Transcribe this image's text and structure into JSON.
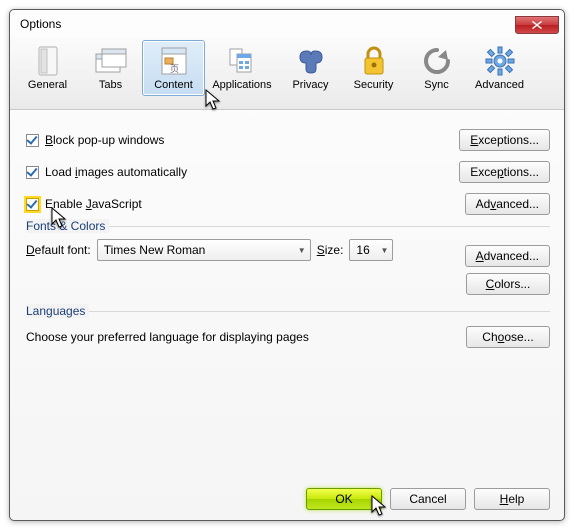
{
  "window": {
    "title": "Options"
  },
  "tabs": [
    {
      "label": "General"
    },
    {
      "label": "Tabs"
    },
    {
      "label": "Content"
    },
    {
      "label": "Applications"
    },
    {
      "label": "Privacy"
    },
    {
      "label": "Security"
    },
    {
      "label": "Sync"
    },
    {
      "label": "Advanced"
    }
  ],
  "content": {
    "block_popups_pre": "",
    "block_popups_key": "B",
    "block_popups_post": "lock pop-up windows",
    "load_images_pre": "Load ",
    "load_images_key": "i",
    "load_images_post": "mages automatically",
    "enable_js_pre": "Enable ",
    "enable_js_key": "J",
    "enable_js_post": "avaScript",
    "exceptions_key": "E",
    "exceptions_rest": "xceptions...",
    "exceptions2_pre": "Exce",
    "exceptions2_key": "p",
    "exceptions2_post": "tions...",
    "advanced_js_pre": "Ad",
    "advanced_js_key": "v",
    "advanced_js_post": "anced..."
  },
  "fonts": {
    "group_title": "Fonts & Colors",
    "default_font_key": "D",
    "default_font_rest": "efault font:",
    "default_font_value": "Times New Roman",
    "size_key": "S",
    "size_rest": "ize:",
    "size_value": "16",
    "advanced_key": "A",
    "advanced_rest": "dvanced...",
    "colors_key": "C",
    "colors_rest": "olors..."
  },
  "languages": {
    "group_title": "Languages",
    "desc": "Choose your preferred language for displaying pages",
    "choose_pre": "Ch",
    "choose_key": "o",
    "choose_post": "ose..."
  },
  "footer": {
    "ok": "OK",
    "cancel": "Cancel",
    "help_key": "H",
    "help_rest": "elp"
  }
}
